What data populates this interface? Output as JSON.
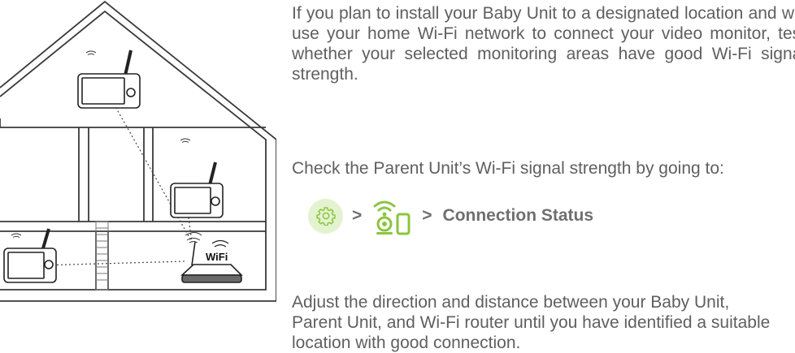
{
  "illustration": {
    "wifi_label": "WiFi"
  },
  "text": {
    "intro": "If you plan to install your Baby Unit to a designated location and will use your home Wi-Fi network to connect your video monitor, test whether your selected monitoring areas have good Wi-Fi signal strength.",
    "check": "Check the Parent Unit’s Wi-Fi signal strength by going to:",
    "adjust": "Adjust the direction and distance between your Baby Unit, Parent Unit, and Wi-Fi router until you have identified a suitable location with good connection."
  },
  "path": {
    "separator_1": ">",
    "separator_2": ">",
    "label": "Connection Status",
    "icons": [
      "gear-icon",
      "camera-phone-connection-icon"
    ]
  },
  "colors": {
    "accent_green": "#8ac53f",
    "text_gray": "#5f5f5f",
    "line_gray": "#3a3a3a"
  }
}
